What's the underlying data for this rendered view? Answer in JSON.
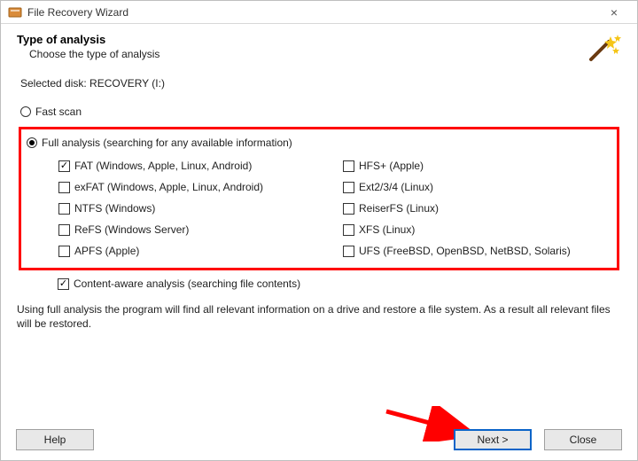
{
  "window": {
    "title": "File Recovery Wizard",
    "close_icon": "×"
  },
  "header": {
    "heading": "Type of analysis",
    "subtitle": "Choose the type of analysis"
  },
  "selected_disk_label": "Selected disk: RECOVERY (I:)",
  "options": {
    "fast_scan": {
      "label": "Fast scan",
      "checked": false
    },
    "full_analysis": {
      "label": "Full analysis (searching for any available information)",
      "checked": true
    }
  },
  "filesystems": {
    "left": [
      {
        "label": "FAT (Windows, Apple, Linux, Android)",
        "checked": true
      },
      {
        "label": "exFAT (Windows, Apple, Linux, Android)",
        "checked": false
      },
      {
        "label": "NTFS (Windows)",
        "checked": false
      },
      {
        "label": "ReFS (Windows Server)",
        "checked": false
      },
      {
        "label": "APFS (Apple)",
        "checked": false
      }
    ],
    "right": [
      {
        "label": "HFS+ (Apple)",
        "checked": false
      },
      {
        "label": "Ext2/3/4 (Linux)",
        "checked": false
      },
      {
        "label": "ReiserFS (Linux)",
        "checked": false
      },
      {
        "label": "XFS (Linux)",
        "checked": false
      },
      {
        "label": "UFS (FreeBSD, OpenBSD, NetBSD, Solaris)",
        "checked": false
      }
    ]
  },
  "content_aware": {
    "label": "Content-aware analysis (searching file contents)",
    "checked": true
  },
  "info_text": "Using full analysis the program will find all relevant information on a drive and restore a file system. As a result all relevant files will be restored.",
  "buttons": {
    "help": "Help",
    "next": "Next >",
    "close": "Close"
  }
}
